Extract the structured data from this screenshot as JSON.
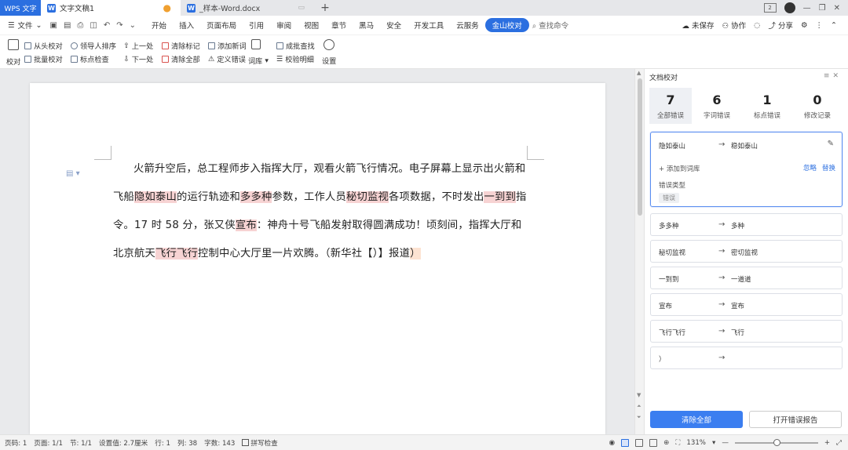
{
  "titlebar": {
    "app_label": "WPS 文字",
    "tabs": [
      {
        "label": "文字文稿1"
      },
      {
        "label": "_样本-Word.docx"
      }
    ]
  },
  "menubar": {
    "file_label": "文件",
    "items": [
      "开始",
      "插入",
      "页面布局",
      "引用",
      "审阅",
      "视图",
      "章节",
      "黑马",
      "安全",
      "开发工具",
      "云服务"
    ],
    "active_item": "金山校对",
    "search_label": "查找命令",
    "unsaved_label": "未保存",
    "collab_label": "协作",
    "share_label": "分享"
  },
  "ribbon": {
    "proofread": "校对",
    "from_start": "从头校对",
    "batch": "批量校对",
    "leader_order": "领导人排序",
    "punct_check": "标点检查",
    "prev": "上一处",
    "next": "下一处",
    "clear_marks": "清除标记",
    "clear_all": "清除全部",
    "add_word": "添加新词",
    "define_error": "定义错误",
    "lexicon": "词库",
    "batch_find": "成批查找",
    "verify_detail": "校验明细",
    "settings": "设置"
  },
  "document": {
    "segments": [
      {
        "text": "火箭升空后，总工程师步入指挥大厅，观看火箭飞行情况。电子屏幕上显示出火箭和飞船",
        "hl": ""
      },
      {
        "text": "隐如泰山",
        "hl": "red"
      },
      {
        "text": "的运行轨迹和",
        "hl": ""
      },
      {
        "text": "多多种",
        "hl": "red"
      },
      {
        "text": "参数，工作人员",
        "hl": ""
      },
      {
        "text": "秘切监视",
        "hl": "red"
      },
      {
        "text": "各项数据，不时发出",
        "hl": ""
      },
      {
        "text": "一到到",
        "hl": "red"
      },
      {
        "text": "指令。17 时 58 分，张又侠",
        "hl": ""
      },
      {
        "text": "宣布",
        "hl": "red"
      },
      {
        "text": "：神舟十号飞船发射取得圆满成功！顷刻间，指挥大厅和北京航天",
        "hl": ""
      },
      {
        "text": "飞行飞行",
        "hl": "red"
      },
      {
        "text": "控制中心大厅里一片欢腾。（新华社【）】报道",
        "hl": ""
      },
      {
        "text": "）",
        "hl": "orange"
      }
    ]
  },
  "panel": {
    "title": "文档校对",
    "stats": [
      {
        "num": "7",
        "label": "全部错误"
      },
      {
        "num": "6",
        "label": "字词错误"
      },
      {
        "num": "1",
        "label": "标点错误"
      },
      {
        "num": "0",
        "label": "修改记录"
      }
    ],
    "selected": {
      "original": "隐如泰山",
      "suggestion": "稳如泰山",
      "add_to_lexicon": "添加到词库",
      "ignore": "忽略",
      "replace": "替换",
      "type_label": "错误类型",
      "type_tag": "错误"
    },
    "errors": [
      {
        "original": "多多种",
        "suggestion": "多种"
      },
      {
        "original": "秘切监视",
        "suggestion": "密切监视"
      },
      {
        "original": "一到到",
        "suggestion": "一道道"
      },
      {
        "original": "宣布",
        "suggestion": "宣布"
      },
      {
        "original": "飞行飞行",
        "suggestion": "飞行"
      },
      {
        "original": "）",
        "suggestion": ""
      }
    ],
    "clear_all": "清除全部",
    "open_report": "打开错误报告"
  },
  "statusbar": {
    "page_num": "页码: 1",
    "pages": "页面: 1/1",
    "section": "节: 1/1",
    "setting": "设置值: 2.7厘米",
    "row": "行: 1",
    "col": "列: 38",
    "words": "字数: 143",
    "spell": "拼写检查",
    "zoom": "131%"
  },
  "colors": {
    "accent": "#2b6fe0",
    "highlight_red": "#f7d3d3",
    "highlight_orange": "#fde3d2"
  }
}
